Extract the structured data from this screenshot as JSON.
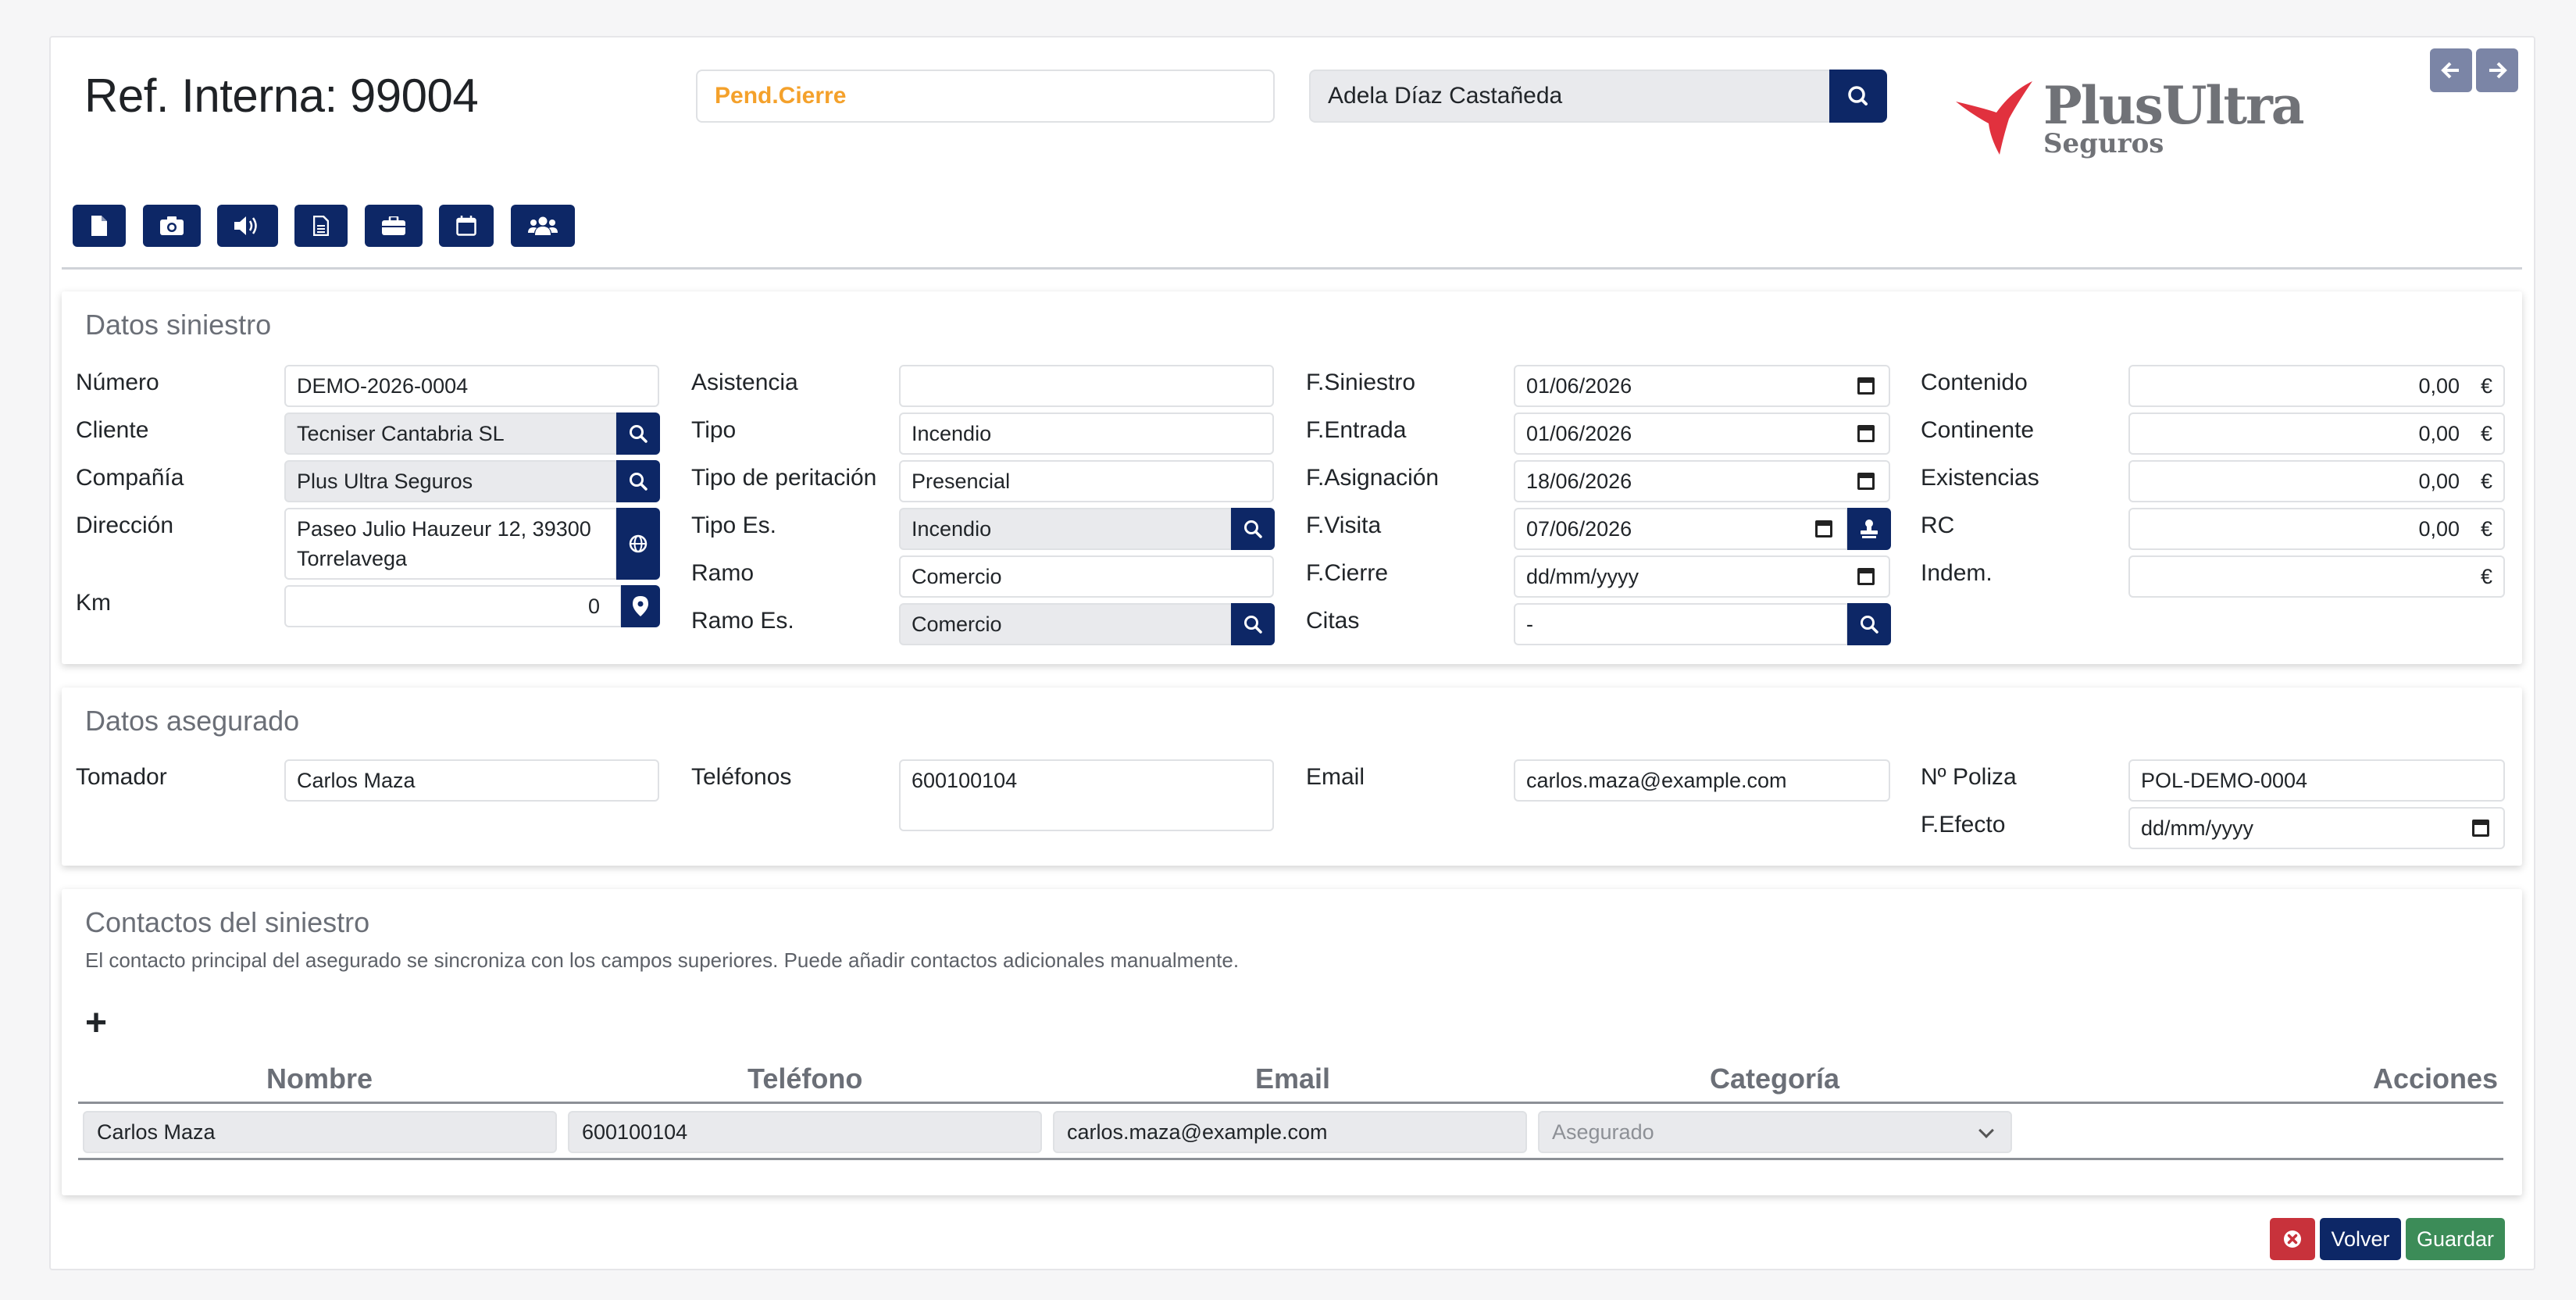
{
  "header": {
    "ref_title": "Ref. Interna: 99004",
    "status": "Pend.Cierre",
    "assignee": "Adela Díaz Castañeda",
    "logo_brand": "PlusUltra",
    "logo_sub": "Seguros"
  },
  "colors": {
    "primary": "#0d2766",
    "status_orange": "#f4a12b",
    "danger": "#c8323b",
    "success": "#3c8c58",
    "logo_red": "#e1313e"
  },
  "toolbar": {
    "icons": [
      "file-icon",
      "camera-icon",
      "volume-icon",
      "document-icon",
      "briefcase-icon",
      "calendar-icon",
      "users-icon"
    ]
  },
  "siniestro": {
    "title": "Datos siniestro",
    "numero_label": "Número",
    "numero": "DEMO-2026-0004",
    "cliente_label": "Cliente",
    "cliente": "Tecniser Cantabria SL",
    "compania_label": "Compañía",
    "compania": "Plus Ultra Seguros",
    "direccion_label": "Dirección",
    "direccion": "Paseo Julio Hauzeur 12, 39300 Torrelavega",
    "km_label": "Km",
    "km": "0",
    "asistencia_label": "Asistencia",
    "asistencia": "",
    "tipo_label": "Tipo",
    "tipo": "Incendio",
    "tipo_peritacion_label": "Tipo de peritación",
    "tipo_peritacion": "Presencial",
    "tipo_es_label": "Tipo Es.",
    "tipo_es": "Incendio",
    "ramo_label": "Ramo",
    "ramo": "Comercio",
    "ramo_es_label": "Ramo Es.",
    "ramo_es": "Comercio",
    "f_siniestro_label": "F.Siniestro",
    "f_siniestro": "01/06/2026",
    "f_entrada_label": "F.Entrada",
    "f_entrada": "01/06/2026",
    "f_asignacion_label": "F.Asignación",
    "f_asignacion": "18/06/2026",
    "f_visita_label": "F.Visita",
    "f_visita": "07/06/2026",
    "f_cierre_label": "F.Cierre",
    "f_cierre": "dd/mm/yyyy",
    "citas_label": "Citas",
    "citas": "-",
    "contenido_label": "Contenido",
    "contenido": "0,00",
    "continente_label": "Continente",
    "continente": "0,00",
    "existencias_label": "Existencias",
    "existencias": "0,00",
    "rc_label": "RC",
    "rc": "0,00",
    "indem_label": "Indem.",
    "indem": "",
    "currency": "€"
  },
  "asegurado": {
    "title": "Datos asegurado",
    "tomador_label": "Tomador",
    "tomador": "Carlos Maza",
    "telefonos_label": "Teléfonos",
    "telefonos": "600100104",
    "email_label": "Email",
    "email": "carlos.maza@example.com",
    "poliza_label": "Nº Poliza",
    "poliza": "POL-DEMO-0004",
    "f_efecto_label": "F.Efecto",
    "f_efecto": "dd/mm/yyyy"
  },
  "contactos": {
    "title": "Contactos del siniestro",
    "note": "El contacto principal del asegurado se sincroniza con los campos superiores. Puede añadir contactos adicionales manualmente.",
    "add_label": "+",
    "columns": [
      "Nombre",
      "Teléfono",
      "Email",
      "Categoría",
      "Acciones"
    ],
    "rows": [
      {
        "nombre": "Carlos Maza",
        "telefono": "600100104",
        "email": "carlos.maza@example.com",
        "categoria": "Asegurado"
      }
    ]
  },
  "footer": {
    "back_label": "Volver",
    "save_label": "Guardar"
  }
}
